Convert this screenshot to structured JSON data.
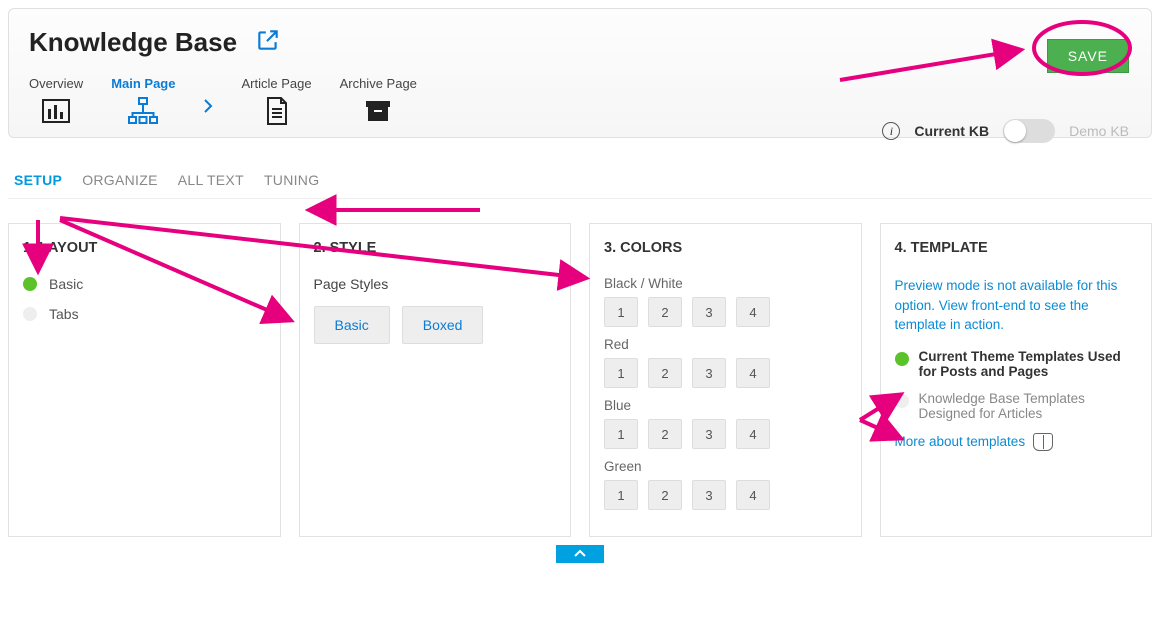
{
  "header": {
    "title": "Knowledge Base",
    "save_label": "SAVE",
    "nav": [
      {
        "label": "Overview",
        "active": false
      },
      {
        "label": "Main Page",
        "active": true
      },
      {
        "label": "Article Page",
        "active": false
      },
      {
        "label": "Archive Page",
        "active": false
      }
    ],
    "kb_toggle": {
      "current_label": "Current KB",
      "demo_label": "Demo KB",
      "state": "current"
    }
  },
  "tabs": [
    {
      "label": "SETUP",
      "active": true
    },
    {
      "label": "ORGANIZE",
      "active": false
    },
    {
      "label": "ALL TEXT",
      "active": false
    },
    {
      "label": "TUNING",
      "active": false
    }
  ],
  "panels": {
    "layout": {
      "title": "1. LAYOUT",
      "options": [
        {
          "label": "Basic",
          "selected": true
        },
        {
          "label": "Tabs",
          "selected": false
        }
      ]
    },
    "style": {
      "title": "2. STYLE",
      "sub_label": "Page Styles",
      "buttons": [
        "Basic",
        "Boxed"
      ]
    },
    "colors": {
      "title": "3. COLORS",
      "groups": [
        {
          "label": "Black / White",
          "swatches": [
            "1",
            "2",
            "3",
            "4"
          ]
        },
        {
          "label": "Red",
          "swatches": [
            "1",
            "2",
            "3",
            "4"
          ]
        },
        {
          "label": "Blue",
          "swatches": [
            "1",
            "2",
            "3",
            "4"
          ]
        },
        {
          "label": "Green",
          "swatches": [
            "1",
            "2",
            "3",
            "4"
          ]
        }
      ]
    },
    "template": {
      "title": "4. TEMPLATE",
      "notice": "Preview mode is not available for this option. View front-end to see the template in action.",
      "options": [
        {
          "label": "Current Theme Templates Used for Posts and Pages",
          "selected": true
        },
        {
          "label": "Knowledge Base Templates Designed for Articles",
          "selected": false
        }
      ],
      "more_link": "More about templates"
    }
  }
}
